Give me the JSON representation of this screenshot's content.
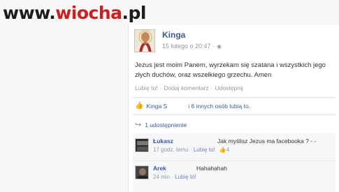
{
  "watermark": {
    "prefix": "www.",
    "accent": "wiocha",
    "suffix": ".pl"
  },
  "post": {
    "author": "Kinga",
    "timestamp": "15 lutego o 20:47 ·",
    "text": "Jezus jest moim Panem, wyrzekam się szatana i wszystkich jego złych duchów, oraz wszelkiego grzechu. Amen",
    "actions": [
      "Lubię to!",
      "Dodaj komentarz",
      "Udostępnij"
    ]
  },
  "likes": {
    "name": "Kinga S",
    "rest": "i 6 innych osób lubią to."
  },
  "shares": {
    "label": "1 udostępnienie"
  },
  "comments": [
    {
      "name": "Łukasz",
      "text": "Jak myślisz Jezus ma facebooka ? - -",
      "time": "17 godz. temu",
      "like": "Lubię to!",
      "likes": "4"
    },
    {
      "name": "Arek",
      "text": "Hahahahah",
      "time": "24 min",
      "like": "Lubię to!"
    }
  ],
  "icons": {
    "globe": "globe-icon",
    "thumb": "thumbs-up-icon",
    "share": "share-arrow-icon"
  }
}
